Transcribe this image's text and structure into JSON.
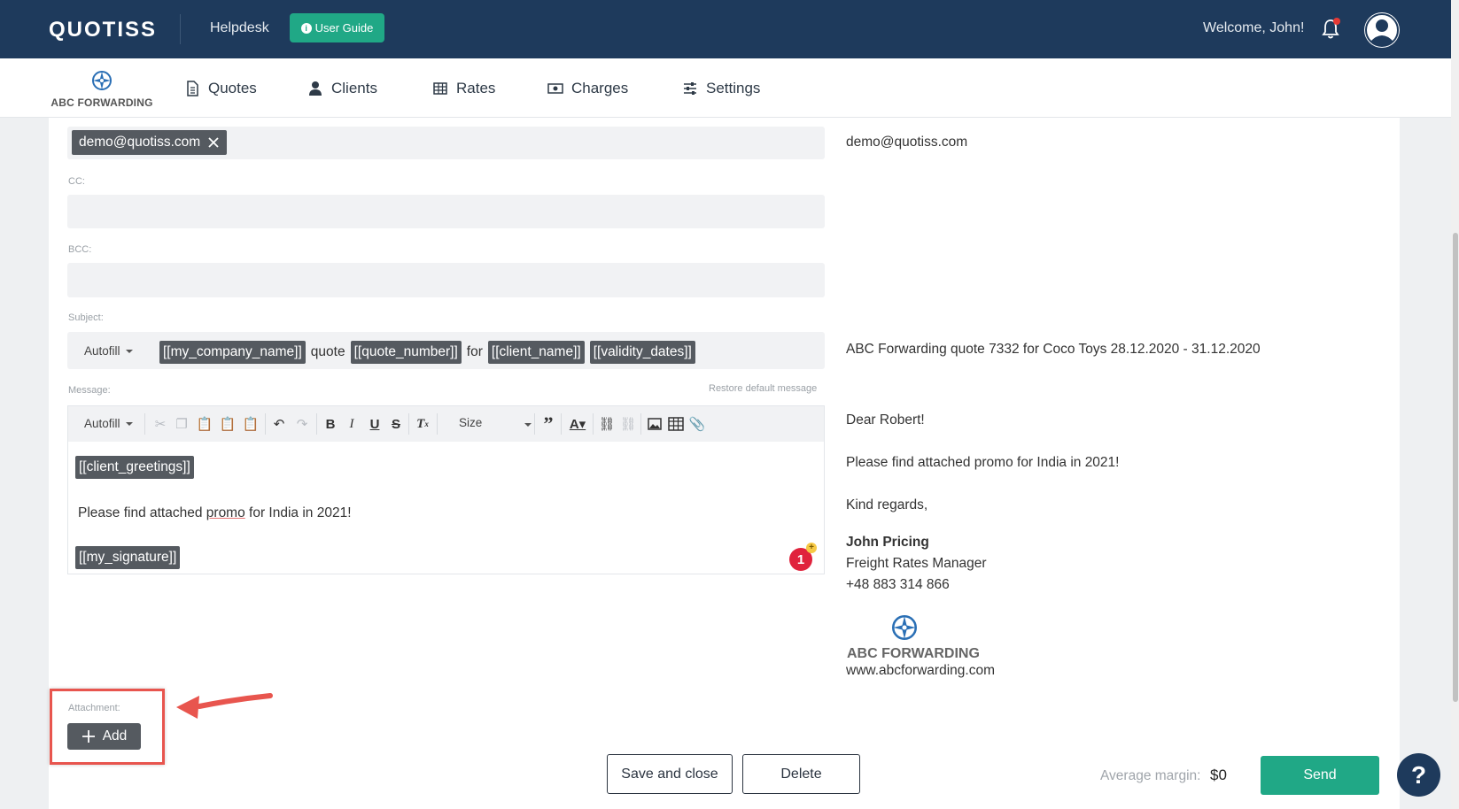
{
  "header": {
    "logo": "QUOTISS",
    "helpdesk": "Helpdesk",
    "user_guide": "User Guide",
    "welcome": "Welcome, John!"
  },
  "nav": {
    "brand": "ABC FORWARDING",
    "items": [
      {
        "label": "Quotes",
        "icon": "document-icon"
      },
      {
        "label": "Clients",
        "icon": "person-icon"
      },
      {
        "label": "Rates",
        "icon": "table-icon"
      },
      {
        "label": "Charges",
        "icon": "cash-icon"
      },
      {
        "label": "Settings",
        "icon": "sliders-icon"
      }
    ]
  },
  "form": {
    "to_chip": "demo@quotiss.com",
    "cc_label": "CC:",
    "bcc_label": "BCC:",
    "subject_label": "Subject:",
    "subject_autofill": "Autofill",
    "subject_parts": [
      "[[my_company_name]]",
      "quote",
      "[[quote_number]]",
      "for",
      "[[client_name]]",
      "[[validity_dates]]"
    ],
    "message_label": "Message:",
    "restore_default": "Restore default message",
    "message_autofill": "Autofill",
    "size_label": "Size",
    "body_greeting": "[[client_greetings]]",
    "body_text_prefix": "Please find attached ",
    "body_text_underlined": "promo",
    "body_text_suffix": " for India in 2021!",
    "body_signature": "[[my_signature]]",
    "badge_count": "1",
    "badge_plus": "+",
    "attachment_label": "Attachment:",
    "add_label": "Add"
  },
  "preview": {
    "to": "demo@quotiss.com",
    "subject": "ABC Forwarding quote 7332 for Coco Toys 28.12.2020 - 31.12.2020",
    "greeting": "Dear Robert!",
    "body": "Please find attached promo for India in 2021!",
    "regards": "Kind regards,",
    "sig_name": "John Pricing",
    "sig_title": "Freight Rates Manager",
    "sig_phone": "+48 883 314 866",
    "sig_brand": "ABC FORWARDING",
    "sig_web": "www.abcforwarding.com"
  },
  "footer": {
    "save_close": "Save and close",
    "delete": "Delete",
    "avg_margin_label": "Average margin:",
    "avg_margin_value": "$0",
    "send": "Send",
    "help": "?"
  },
  "colors": {
    "header_bg": "#1e3a5c",
    "accent_green": "#20a886",
    "chip_bg": "#555a60",
    "highlight_red": "#e8554e"
  }
}
